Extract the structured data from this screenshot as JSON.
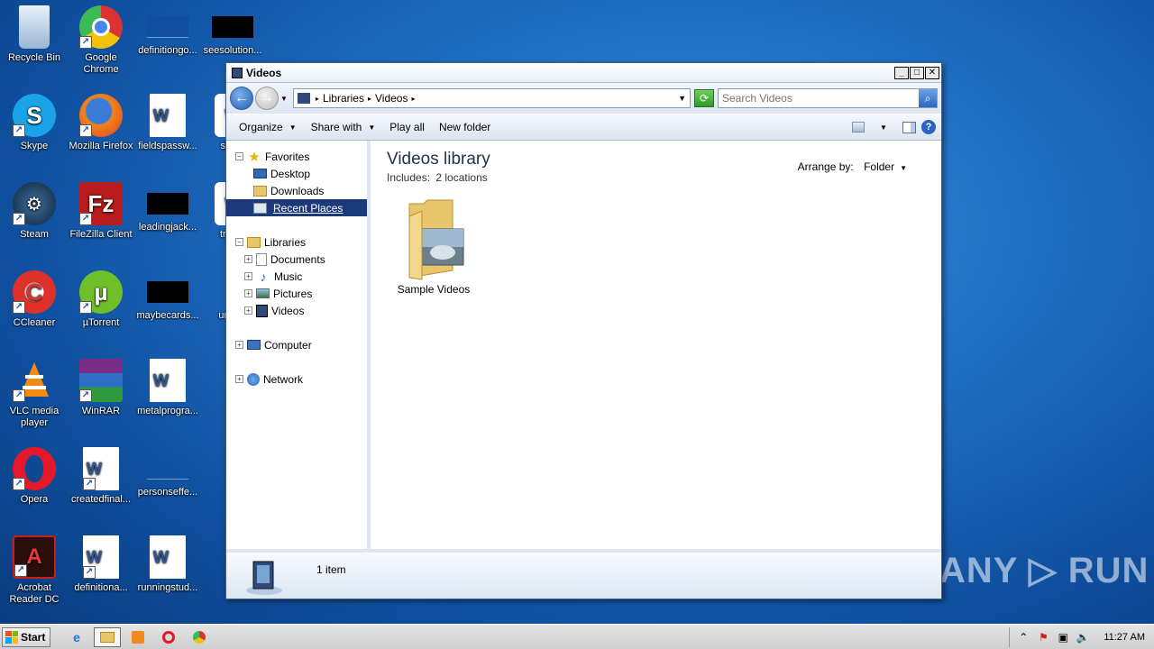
{
  "desktop": {
    "icons": [
      {
        "label": "Recycle Bin",
        "icon": "recycle-bin-icon"
      },
      {
        "label": "Google Chrome",
        "icon": "chrome-icon"
      },
      {
        "label": "definitiongo...",
        "icon": "document-icon"
      },
      {
        "label": "seesolution...",
        "icon": "document-icon"
      },
      {
        "label": "Skype",
        "icon": "skype-icon"
      },
      {
        "label": "Mozilla Firefox",
        "icon": "firefox-icon"
      },
      {
        "label": "fieldspassw...",
        "icon": "word-document-icon"
      },
      {
        "label": "sho...",
        "icon": "word-document-icon"
      },
      {
        "label": "Steam",
        "icon": "steam-icon"
      },
      {
        "label": "FileZilla Client",
        "icon": "filezilla-icon"
      },
      {
        "label": "leadingjack...",
        "icon": "document-icon"
      },
      {
        "label": "tree...",
        "icon": "word-document-icon"
      },
      {
        "label": "CCleaner",
        "icon": "ccleaner-icon"
      },
      {
        "label": "µTorrent",
        "icon": "utorrent-icon"
      },
      {
        "label": "maybecards...",
        "icon": "document-icon"
      },
      {
        "label": "unra...",
        "icon": "document-icon"
      },
      {
        "label": "VLC media player",
        "icon": "vlc-icon"
      },
      {
        "label": "WinRAR",
        "icon": "winrar-icon"
      },
      {
        "label": "metalprogra...",
        "icon": "word-document-icon"
      },
      {
        "label": "Opera",
        "icon": "opera-icon"
      },
      {
        "label": "createdfinal...",
        "icon": "word-document-icon"
      },
      {
        "label": "personseffe...",
        "icon": "document-icon"
      },
      {
        "label": "Acrobat Reader DC",
        "icon": "acrobat-icon"
      },
      {
        "label": "definitiona...",
        "icon": "word-document-icon"
      },
      {
        "label": "runningstud...",
        "icon": "word-document-icon"
      }
    ]
  },
  "window": {
    "title": "Videos",
    "address": {
      "crumbs": [
        "Libraries",
        "Videos"
      ]
    },
    "search": {
      "placeholder": "Search Videos"
    },
    "toolbar": {
      "organize": "Organize",
      "share_with": "Share with",
      "play_all": "Play all",
      "new_folder": "New folder"
    },
    "navpane": {
      "favorites": "Favorites",
      "desktop": "Desktop",
      "downloads": "Downloads",
      "recent_places": "Recent Places",
      "libraries": "Libraries",
      "documents": "Documents",
      "music": "Music",
      "pictures": "Pictures",
      "videos": "Videos",
      "computer": "Computer",
      "network": "Network"
    },
    "content": {
      "title": "Videos library",
      "includes_label": "Includes:",
      "includes_value": "2 locations",
      "arrange_label": "Arrange by:",
      "arrange_value": "Folder",
      "items": [
        {
          "label": "Sample Videos"
        }
      ]
    },
    "details": {
      "count": "1 item"
    }
  },
  "taskbar": {
    "start": "Start",
    "clock": "11:27 AM"
  },
  "watermark": "ANY ▷ RUN"
}
